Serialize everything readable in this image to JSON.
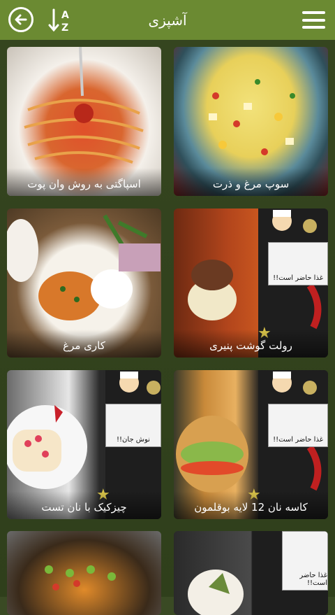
{
  "app_bar": {
    "title": "آشپزی",
    "back_icon": "arrow-left-circle-icon",
    "sort_icon": "sort-a-z-icon",
    "menu_icon": "hamburger-menu-icon",
    "color": "#6b8a32",
    "sort_letters": {
      "top": "A",
      "bottom": "Z"
    }
  },
  "recipes": [
    {
      "title": "سوپ مرغ و ذرت"
    },
    {
      "title": "اسپاگتی به روش وان پوت"
    },
    {
      "title": "رولت گوشت پنیری"
    },
    {
      "title": "کاری مرغ"
    },
    {
      "title": "کاسه نان 12 لایه بوقلمون"
    },
    {
      "title": "چیزکیک با نان تست"
    },
    {
      "title": ""
    },
    {
      "title": ""
    }
  ],
  "signs": {
    "ready": "غذا حاضر است!!",
    "bon": "نوش جان!!"
  }
}
